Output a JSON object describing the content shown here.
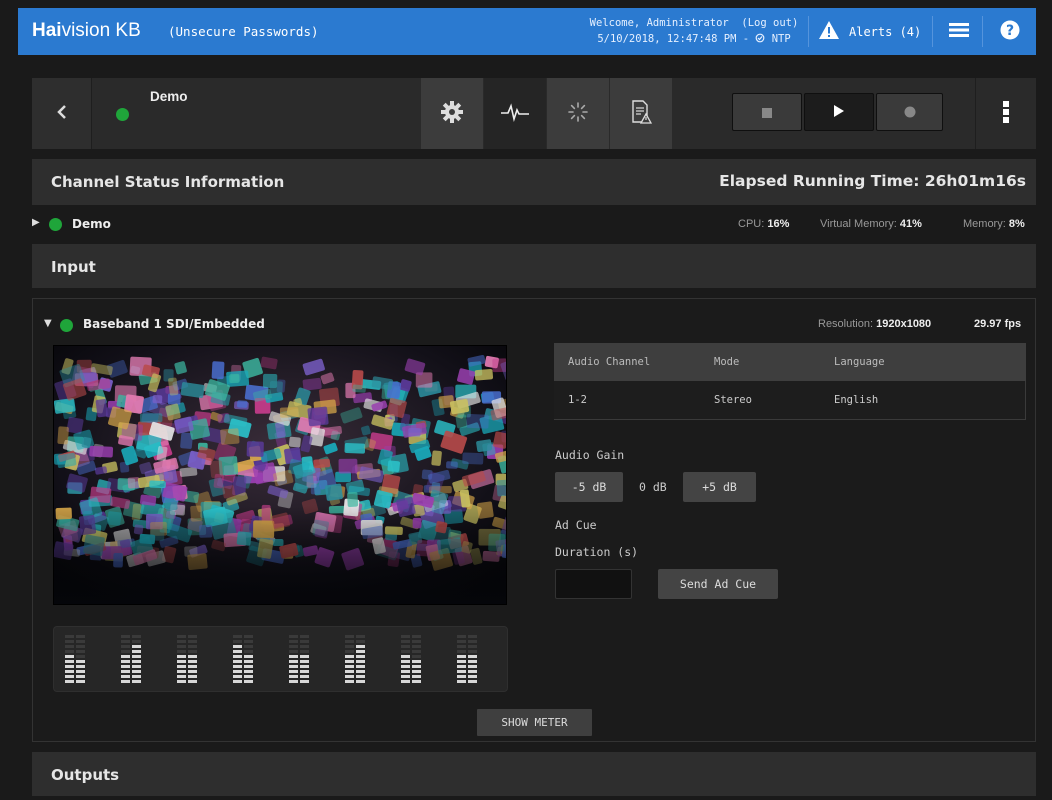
{
  "header": {
    "brand_strong": "Hai",
    "brand_rest": "vision KB",
    "subtitle": "(Unsecure Passwords)",
    "welcome": "Welcome, Administrator",
    "logout": "(Log out)",
    "datetime": "5/10/2018, 12:47:48 PM",
    "ntp": "NTP",
    "alerts_label": "Alerts (4)",
    "icons": [
      "warning-icon",
      "hamburger-menu-icon",
      "help-icon",
      "ntp-sync-icon"
    ]
  },
  "channel": {
    "name": "Demo",
    "status_color": "#1fa53a",
    "toolbar_icons": [
      "back-arrow-icon",
      "gear-icon",
      "waveform-icon",
      "loading-spinner-icon",
      "document-warning-icon",
      "stop-icon",
      "play-icon",
      "record-icon",
      "more-vertical-icon"
    ]
  },
  "status_section": {
    "title": "Channel Status Information",
    "elapsed": "Elapsed Running Time: 26h01m16s",
    "row_name": "Demo",
    "cpu_label": "CPU:",
    "cpu_value": "16%",
    "vmem_label": "Virtual Memory:",
    "vmem_value": "41%",
    "mem_label": "Memory:",
    "mem_value": "8%"
  },
  "input_section": {
    "title": "Input",
    "source_name": "Baseband 1 SDI/Embedded",
    "resolution_label": "Resolution:",
    "resolution_value": "1920x1080",
    "fps": "29.97 fps",
    "audio_table": {
      "headers": [
        "Audio Channel",
        "Mode",
        "Language"
      ],
      "rows": [
        [
          "1-2",
          "Stereo",
          "English"
        ]
      ]
    },
    "audio_gain_label": "Audio Gain",
    "minus_gain": "-5 dB",
    "gain_value": "0 dB",
    "plus_gain": "+5 dB",
    "ad_cue_label": "Ad Cue",
    "duration_label": "Duration (s)",
    "duration_value": "",
    "send_ad_cue": "Send Ad Cue",
    "show_meter": "SHOW METER",
    "meter_levels": [
      [
        0.55,
        0.45
      ],
      [
        0.55,
        0.75
      ],
      [
        0.55,
        0.55
      ],
      [
        0.75,
        0.55
      ],
      [
        0.55,
        0.55
      ],
      [
        0.55,
        0.75
      ],
      [
        0.55,
        0.45
      ],
      [
        0.55,
        0.55
      ]
    ]
  },
  "outputs_section": {
    "title": "Outputs"
  }
}
